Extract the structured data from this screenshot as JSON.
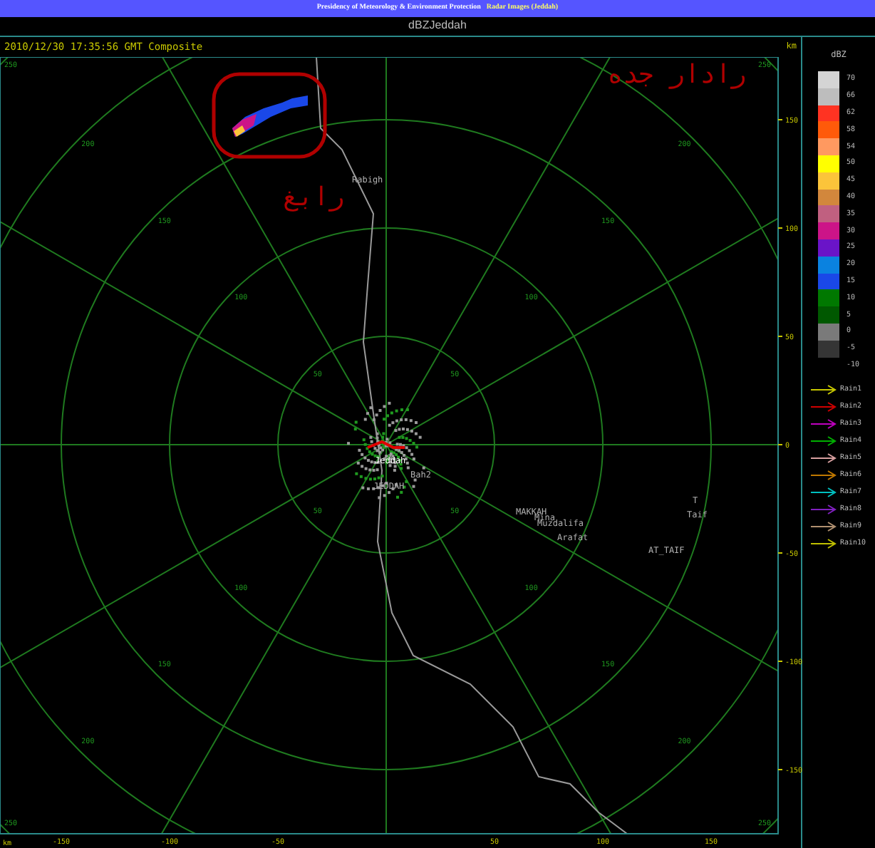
{
  "banner": {
    "title": "Presidency of Meteorology & Environment Protection",
    "subtitle": "Radar Images (Jeddah)"
  },
  "product": "dBZJeddah",
  "timestamp": "2010/12/30 17:35:56 GMT Composite",
  "map": {
    "unit_top": "km",
    "unit_bottom": "km",
    "corner_labels": [
      "250",
      "250",
      "250",
      "250"
    ],
    "y_labels": [
      "150",
      "100",
      "50",
      "0",
      "-50",
      "-100",
      "-150"
    ],
    "x_labels": [
      "-150",
      "-100",
      "-50",
      "50",
      "100",
      "150"
    ],
    "rings": [
      {
        "labels": [
          "50",
          "50",
          "50",
          "50"
        ]
      },
      {
        "labels": [
          "100",
          "100",
          "100",
          "100"
        ]
      },
      {
        "labels": [
          "150",
          "150",
          "150",
          "150"
        ]
      },
      {
        "labels": [
          "200",
          "200",
          "200",
          "200"
        ]
      }
    ],
    "places": [
      "Rabigh",
      "Jeddah",
      "Bah2",
      "JEDDAH",
      "MAKKAH",
      "Mina",
      "Muzdalifa",
      "Arafat",
      "T",
      "Taif",
      "AT_TAIF"
    ],
    "arabic_labels": [
      "رادار جده",
      "رابغ"
    ]
  },
  "legend": {
    "title": "dBZ",
    "scale": [
      {
        "label": "70",
        "color": "#d4d4d4"
      },
      {
        "label": "66",
        "color": "#bdbdbd"
      },
      {
        "label": "62",
        "color": "#ff3322"
      },
      {
        "label": "58",
        "color": "#ff5a0a"
      },
      {
        "label": "54",
        "color": "#ff9960"
      },
      {
        "label": "50",
        "color": "#ffff00"
      },
      {
        "label": "45",
        "color": "#fbc43a"
      },
      {
        "label": "40",
        "color": "#d2873c"
      },
      {
        "label": "35",
        "color": "#c06080"
      },
      {
        "label": "30",
        "color": "#cc1488"
      },
      {
        "label": "25",
        "color": "#6a14c8"
      },
      {
        "label": "20",
        "color": "#0a82e0"
      },
      {
        "label": "15",
        "color": "#1a48e8"
      },
      {
        "label": "10",
        "color": "#007800"
      },
      {
        "label": "5",
        "color": "#005800"
      },
      {
        "label": "0",
        "color": "#7a7a7a"
      },
      {
        "label": "-5",
        "color": "#353535"
      },
      {
        "label": "-10",
        "color": "#000000"
      }
    ],
    "rain": [
      {
        "label": "Rain1",
        "color": "#c8c800"
      },
      {
        "label": "Rain2",
        "color": "#d00000"
      },
      {
        "label": "Rain3",
        "color": "#c000c0"
      },
      {
        "label": "Rain4",
        "color": "#00b000"
      },
      {
        "label": "Rain5",
        "color": "#d8a0a0"
      },
      {
        "label": "Rain6",
        "color": "#c07800"
      },
      {
        "label": "Rain7",
        "color": "#00c0c0"
      },
      {
        "label": "Rain8",
        "color": "#8020c0"
      },
      {
        "label": "Rain9",
        "color": "#b09070"
      },
      {
        "label": "Rain10",
        "color": "#c0c000"
      }
    ]
  }
}
